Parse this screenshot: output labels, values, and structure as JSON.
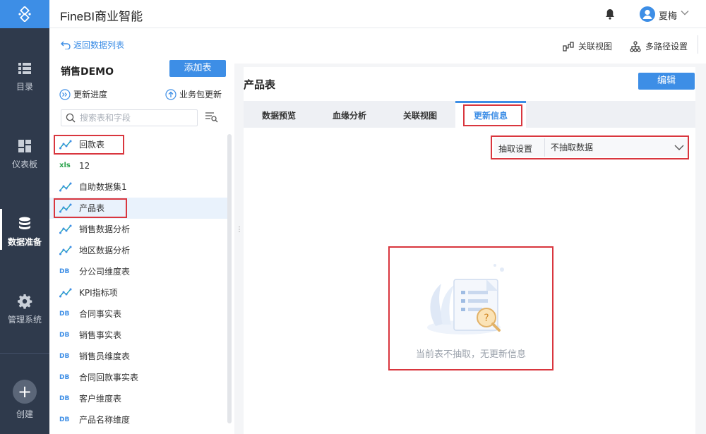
{
  "app": {
    "title": "FineBI商业智能"
  },
  "user": {
    "name": "夏梅"
  },
  "rail": {
    "items": [
      {
        "label": "目录",
        "icon": "list-icon"
      },
      {
        "label": "仪表板",
        "icon": "dashboard-icon"
      },
      {
        "label": "数据准备",
        "icon": "database-icon",
        "active": true
      },
      {
        "label": "管理系统",
        "icon": "gear-icon"
      }
    ],
    "create_label": "创建"
  },
  "left": {
    "back_label": "返回数据列表",
    "package_name": "销售DEMO",
    "add_table_label": "添加表",
    "update_progress_label": "更新进度",
    "package_update_label": "业务包更新",
    "search_placeholder": "搜索表和字段",
    "tables": [
      {
        "name": "回款表",
        "type": "analysis",
        "highlighted": true
      },
      {
        "name": "12",
        "type": "xls"
      },
      {
        "name": "自助数据集1",
        "type": "analysis"
      },
      {
        "name": "产品表",
        "type": "analysis",
        "selected": true,
        "highlighted": true
      },
      {
        "name": "销售数据分析",
        "type": "analysis"
      },
      {
        "name": "地区数据分析",
        "type": "analysis"
      },
      {
        "name": "分公司维度表",
        "type": "db"
      },
      {
        "name": "KPI指标项",
        "type": "analysis"
      },
      {
        "name": "合同事实表",
        "type": "db"
      },
      {
        "name": "销售事实表",
        "type": "db"
      },
      {
        "name": "销售员维度表",
        "type": "db"
      },
      {
        "name": "合同回款事实表",
        "type": "db"
      },
      {
        "name": "客户维度表",
        "type": "db"
      },
      {
        "name": "产品名称维度",
        "type": "db"
      }
    ],
    "type_badges": {
      "xls": "xls",
      "db": "DB"
    }
  },
  "right": {
    "relation_view_label": "关联视图",
    "multipath_label": "多路径设置",
    "table_title": "产品表",
    "edit_label": "编辑",
    "tabs": [
      "数据预览",
      "血缘分析",
      "关联视图",
      "更新信息"
    ],
    "active_tab": "更新信息",
    "extract_label": "抽取设置",
    "extract_value": "不抽取数据",
    "empty_message": "当前表不抽取，无更新信息"
  },
  "colors": {
    "accent": "#3d8ee6",
    "highlight_box": "#d9363e",
    "rail_bg": "#2f3a4c"
  }
}
